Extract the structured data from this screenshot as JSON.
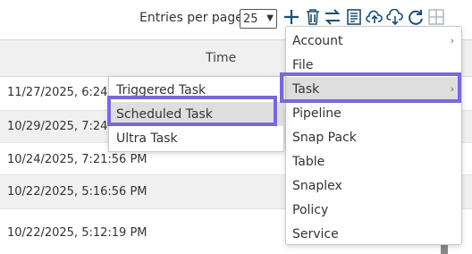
{
  "toolbar": {
    "entries_label": "Entries per page:",
    "entries_value": "25",
    "icons": [
      "plus-icon",
      "trash-icon",
      "swap-icon",
      "document-icon",
      "upload-icon",
      "download-icon",
      "refresh-icon",
      "grid-icon"
    ],
    "accent_color": "#1d4e73"
  },
  "table": {
    "time_header": "Time",
    "rows": [
      "11/27/2025, 6:24:2",
      "10/29/2025, 7:24:",
      "10/24/2025, 7:21:56 PM",
      "10/22/2025, 5:16:56 PM",
      "10/22/2025, 5:12:19 PM"
    ]
  },
  "menu": {
    "items": [
      "Account",
      "File",
      "Task",
      "Pipeline",
      "Snap Pack",
      "Table",
      "Snaplex",
      "Policy",
      "Service"
    ],
    "highlight_color": "#7b68d6"
  },
  "submenu": {
    "items": [
      "Triggered Task",
      "Scheduled Task",
      "Ultra Task"
    ]
  }
}
